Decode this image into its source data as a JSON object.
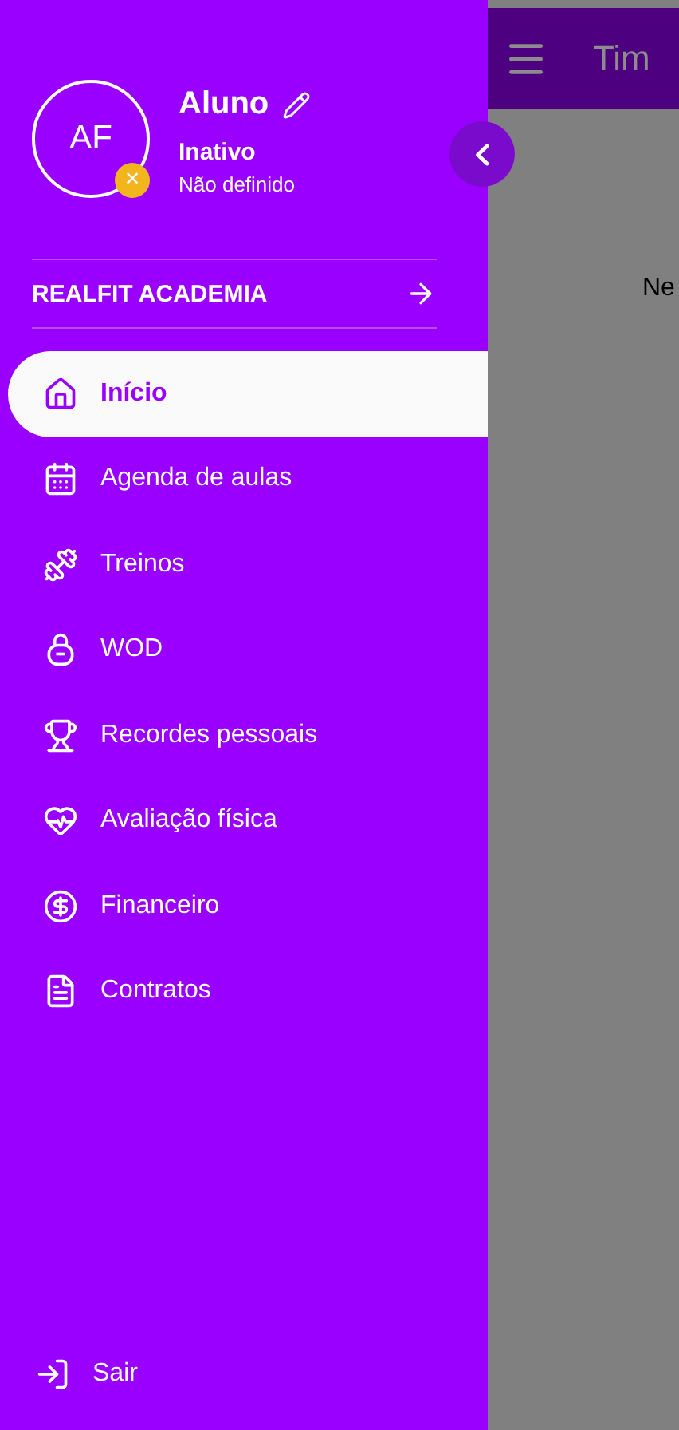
{
  "drawer": {
    "avatar_initials": "AF",
    "status_badge": "×",
    "name": "Aluno",
    "status": "Inativo",
    "plan": "Não definido",
    "gym": "REALFIT ACADEMIA",
    "menu": [
      {
        "label": "Início",
        "selected": true
      },
      {
        "label": "Agenda de aulas",
        "selected": false
      },
      {
        "label": "Treinos",
        "selected": false
      },
      {
        "label": "WOD",
        "selected": false
      },
      {
        "label": "Recordes pessoais",
        "selected": false
      },
      {
        "label": "Avaliação física",
        "selected": false
      },
      {
        "label": "Financeiro",
        "selected": false
      },
      {
        "label": "Contratos",
        "selected": false
      }
    ],
    "logout": "Sair"
  },
  "background_app": {
    "title": "Tim",
    "text": "Ne"
  }
}
